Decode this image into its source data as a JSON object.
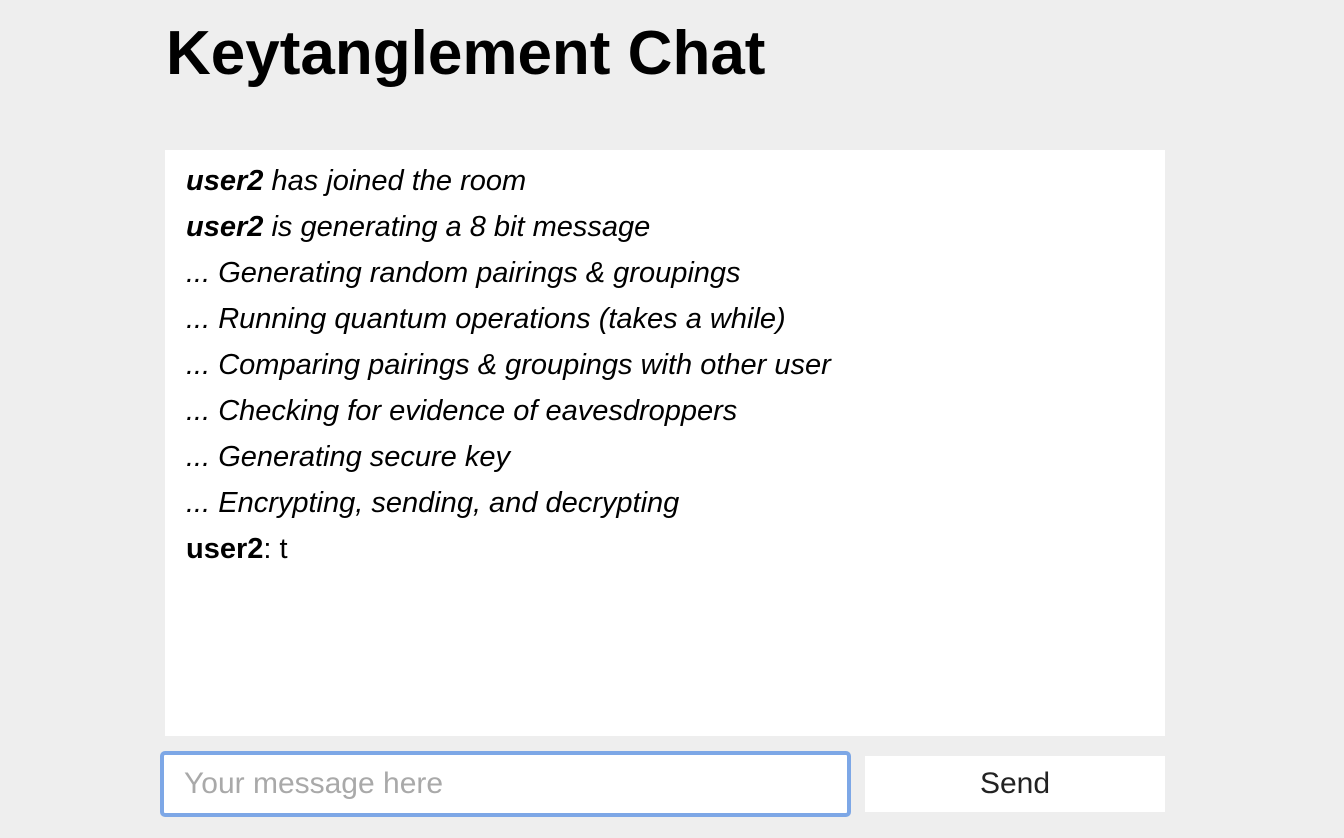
{
  "app": {
    "title": "Keytanglement Chat"
  },
  "messages": [
    {
      "kind": "system",
      "user": "user2",
      "text": " has joined the room"
    },
    {
      "kind": "system",
      "user": "user2",
      "text": " is generating a 8 bit message"
    },
    {
      "kind": "status",
      "text": "... Generating random pairings & groupings"
    },
    {
      "kind": "status",
      "text": "... Running quantum operations (takes a while)"
    },
    {
      "kind": "status",
      "text": "... Comparing pairings & groupings with other user"
    },
    {
      "kind": "status",
      "text": "... Checking for evidence of eavesdroppers"
    },
    {
      "kind": "status",
      "text": "... Generating secure key"
    },
    {
      "kind": "status",
      "text": "... Encrypting, sending, and decrypting"
    },
    {
      "kind": "chat",
      "user": "user2",
      "text": ": t"
    }
  ],
  "composer": {
    "placeholder": "Your message here",
    "value": "",
    "send_label": "Send"
  }
}
